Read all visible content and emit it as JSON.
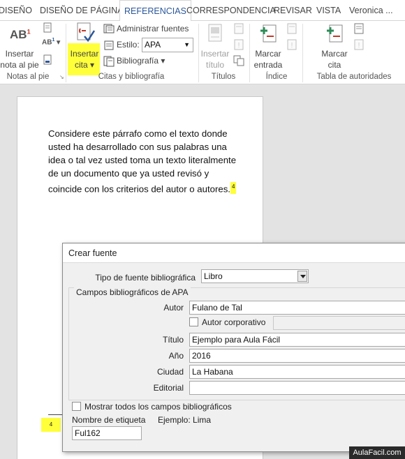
{
  "tabs": [
    {
      "label": "DISEÑO"
    },
    {
      "label": "DISEÑO DE PÁGINA"
    },
    {
      "label": "REFERENCIAS"
    },
    {
      "label": "CORRESPONDENCIA"
    },
    {
      "label": "REVISAR"
    },
    {
      "label": "VISTA"
    },
    {
      "label": "Veronica ..."
    }
  ],
  "ribbon": {
    "footnotes": {
      "line1": "Insertar",
      "line2": "nota al pie",
      "group": "Notas al pie",
      "icon_text": "AB",
      "icon_sup": "1"
    },
    "citations": {
      "insert_line1": "Insertar",
      "insert_line2": "cita",
      "manage_label": "Administrar fuentes",
      "style_label": "Estilo:",
      "style_value": "APA",
      "bibliography_label": "Bibliografía",
      "group": "Citas y bibliografía"
    },
    "captions": {
      "line1": "Insertar",
      "line2": "título",
      "group": "Títulos"
    },
    "index": {
      "line1": "Marcar",
      "line2": "entrada",
      "group": "Índice"
    },
    "authorities": {
      "line1": "Marcar",
      "line2": "cita",
      "group": "Tabla de autoridades"
    },
    "colors": {
      "accent": "#2b579a",
      "highlight": "#ffff3a",
      "icon_red": "#c0392b",
      "icon_green": "#2e8b57"
    }
  },
  "document": {
    "lines": [
      "Considere este párrafo como el texto donde",
      "usted ha desarrollado con sus palabras una",
      "idea o tal vez usted toma un texto literalmente",
      "de un documento que ya usted revisó y",
      "coincide con los criterios del autor o autores."
    ],
    "citation_mark": "4",
    "footnote_number": "4"
  },
  "dialog": {
    "title": "Crear fuente",
    "type_label": "Tipo de fuente bibliográfica",
    "type_value": "Libro",
    "group_label": "Campos bibliográficos de APA",
    "fields": {
      "author_label": "Autor",
      "author_value": "Fulano de Tal",
      "corporate_label": "Autor corporativo",
      "title_label": "Título",
      "title_value": "Ejemplo para Aula Fácil",
      "year_label": "Año",
      "year_value": "2016",
      "city_label": "Ciudad",
      "city_value": "La Habana",
      "publisher_label": "Editorial",
      "publisher_value": ""
    },
    "show_all_label": "Mostrar todos los campos bibliográficos",
    "tag_label": "Nombre de etiqueta",
    "example_label": "Ejemplo: Lima",
    "tag_value": "Ful162"
  },
  "watermark": "AulaFacil.com"
}
